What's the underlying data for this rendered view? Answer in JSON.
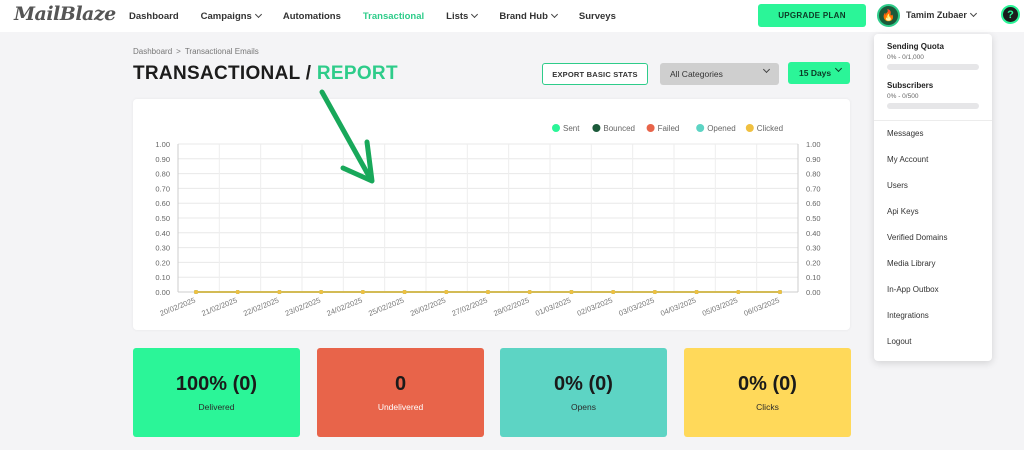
{
  "app": {
    "logo": "MailBlaze"
  },
  "nav": [
    {
      "label": "Dashboard",
      "dropdown": false,
      "active": false
    },
    {
      "label": "Campaigns",
      "dropdown": true,
      "active": false
    },
    {
      "label": "Automations",
      "dropdown": false,
      "active": false
    },
    {
      "label": "Transactional",
      "dropdown": false,
      "active": true
    },
    {
      "label": "Lists",
      "dropdown": true,
      "active": false
    },
    {
      "label": "Brand Hub",
      "dropdown": true,
      "active": false
    },
    {
      "label": "Surveys",
      "dropdown": false,
      "active": false
    }
  ],
  "header": {
    "upgrade_label": "UPGRADE PLAN",
    "user_name": "Tamim Zubaer",
    "help_symbol": "?"
  },
  "breadcrumb": {
    "root": "Dashboard",
    "separator": ">",
    "current": "Transactional Emails"
  },
  "title": {
    "main": "TRANSACTIONAL / ",
    "accent": "REPORT"
  },
  "controls": {
    "export_label": "EXPORT BASIC STATS",
    "category_value": "All Categories",
    "days_value": "15 Days"
  },
  "chart_data": {
    "type": "line",
    "x": [
      "20/02/2025",
      "21/02/2025",
      "22/02/2025",
      "23/02/2025",
      "24/02/2025",
      "25/02/2025",
      "26/02/2025",
      "27/02/2025",
      "28/02/2025",
      "01/03/2025",
      "02/03/2025",
      "03/03/2025",
      "04/03/2025",
      "05/03/2025",
      "06/03/2025"
    ],
    "series": [
      {
        "name": "Sent",
        "color": "#2bf598",
        "values": [
          0,
          0,
          0,
          0,
          0,
          0,
          0,
          0,
          0,
          0,
          0,
          0,
          0,
          0,
          0
        ]
      },
      {
        "name": "Bounced",
        "color": "#1b5a3a",
        "values": [
          0,
          0,
          0,
          0,
          0,
          0,
          0,
          0,
          0,
          0,
          0,
          0,
          0,
          0,
          0
        ]
      },
      {
        "name": "Failed",
        "color": "#e8644a",
        "values": [
          0,
          0,
          0,
          0,
          0,
          0,
          0,
          0,
          0,
          0,
          0,
          0,
          0,
          0,
          0
        ]
      },
      {
        "name": "Opened",
        "color": "#5dd4c4",
        "values": [
          0,
          0,
          0,
          0,
          0,
          0,
          0,
          0,
          0,
          0,
          0,
          0,
          0,
          0,
          0
        ]
      },
      {
        "name": "Clicked",
        "color": "#f0c040",
        "values": [
          0,
          0,
          0,
          0,
          0,
          0,
          0,
          0,
          0,
          0,
          0,
          0,
          0,
          0,
          0
        ]
      }
    ],
    "yticks": [
      "1.00",
      "0.90",
      "0.80",
      "0.70",
      "0.60",
      "0.50",
      "0.40",
      "0.30",
      "0.20",
      "0.10",
      "0.00"
    ],
    "ylim": [
      0,
      1
    ],
    "legend_position": "top-right",
    "grid": true,
    "dual_y_axis": true
  },
  "stats": [
    {
      "value": "100% (0)",
      "label": "Delivered",
      "color": "#2bf598"
    },
    {
      "value": "0",
      "label": "Undelivered",
      "color": "#e8644a"
    },
    {
      "value": "0% (0)",
      "label": "Opens",
      "color": "#5dd4c4"
    },
    {
      "value": "0% (0)",
      "label": "Clicks",
      "color": "#ffd95a"
    }
  ],
  "user_menu": {
    "quota": [
      {
        "title": "Sending Quota",
        "sub": "0% - 0/1,000",
        "fraction": 0
      },
      {
        "title": "Subscribers",
        "sub": "0% - 0/500",
        "fraction": 0
      }
    ],
    "items": [
      "Messages",
      "My Account",
      "Users",
      "Api Keys",
      "Verified Domains",
      "Media Library",
      "In-App Outbox",
      "Integrations",
      "Logout"
    ]
  },
  "annotation": {
    "color": "#18a85a"
  }
}
